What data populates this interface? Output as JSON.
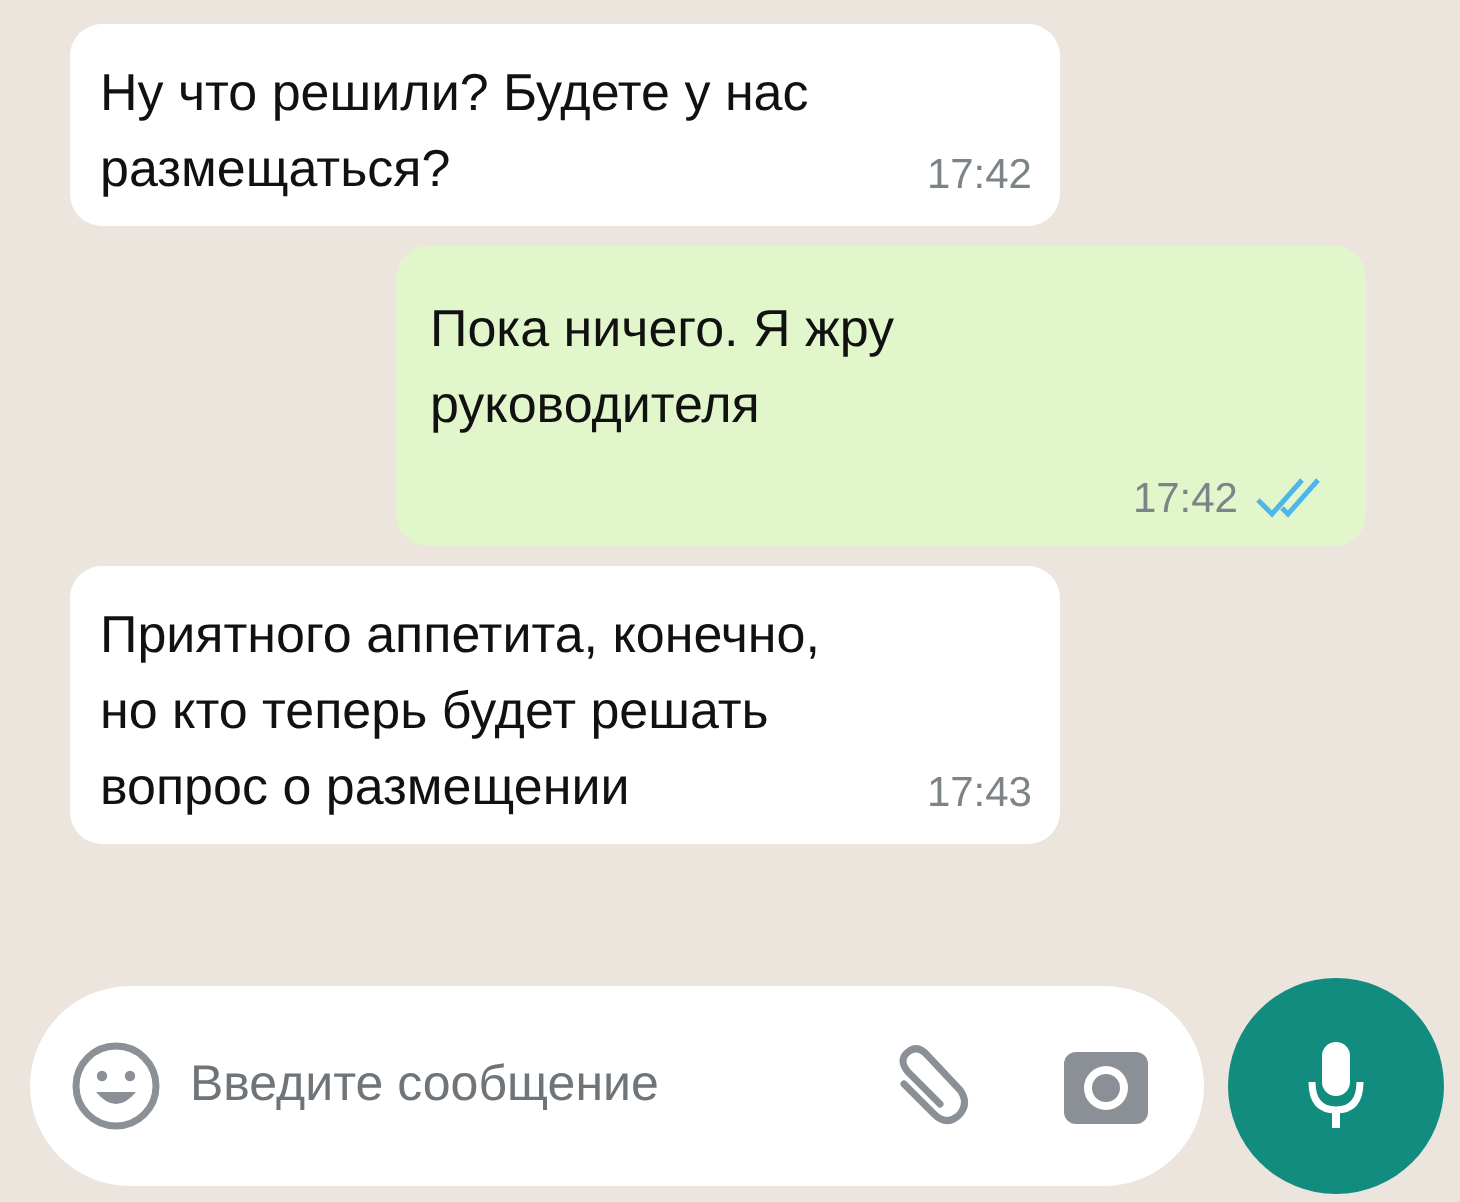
{
  "messages": [
    {
      "kind": "incoming",
      "text": "Ну что решили? Будете у нас размещаться?",
      "time": "17:42"
    },
    {
      "kind": "outgoing",
      "text": "Пока ничего. Я жру руководителя",
      "time": "17:42",
      "read": true
    },
    {
      "kind": "incoming",
      "text": "Приятного аппетита, конечно, но кто теперь будет решать вопрос о размещении",
      "time": "17:43"
    }
  ],
  "composer": {
    "placeholder": "Введите сообщение"
  }
}
